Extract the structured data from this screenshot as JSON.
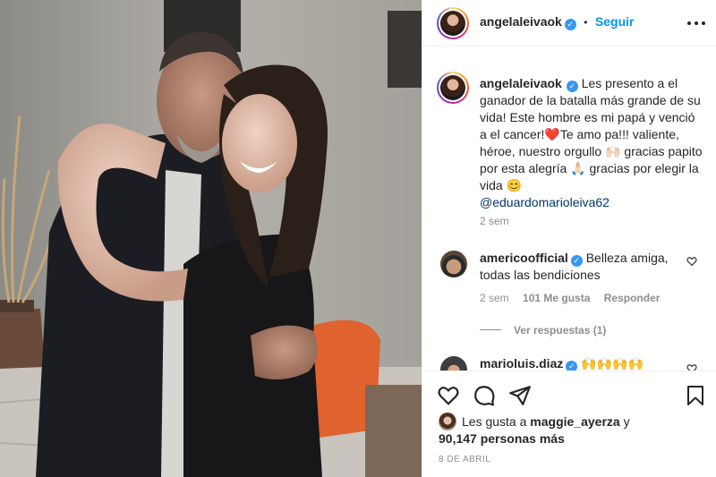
{
  "post": {
    "username": "angelaleivaok",
    "follow_label": "Seguir",
    "separator": "•",
    "more_label": "•••"
  },
  "caption": {
    "username": "angelaleivaok",
    "text_1": "Les presento a el ganador de la batalla más grande de su vida! Este hombre es mi papá y venció a el cancer!",
    "text_2": "Te amo pa!!! valiente, héroe, nuestro orgullo ",
    "text_3": " gracias papito por esta alegría ",
    "text_4": " gracias por elegir la vida ",
    "mention": "@eduardomarioleiva62",
    "time": "2 sem"
  },
  "comments": [
    {
      "username": "americoofficial",
      "text": "Belleza amiga, todas las bendiciones",
      "time": "2 sem",
      "likes": "101 Me gusta",
      "reply": "Responder",
      "view_replies": "Ver respuestas (1)"
    },
    {
      "username": "marioluis.diaz",
      "text": "🙌🙌🙌🙌"
    }
  ],
  "likes": {
    "prefix": "Les gusta a ",
    "user": "maggie_ayerza",
    "connector": " y",
    "count": "90,147 personas más"
  },
  "date": "8 DE ABRIL",
  "colors": {
    "accent": "#0095f6",
    "verified": "#3897f0",
    "heart": "#ed4956",
    "muted": "#8e8e8e"
  },
  "icons": [
    "heart-icon",
    "comment-icon",
    "share-icon",
    "bookmark-icon",
    "verified-icon",
    "more-icon"
  ]
}
